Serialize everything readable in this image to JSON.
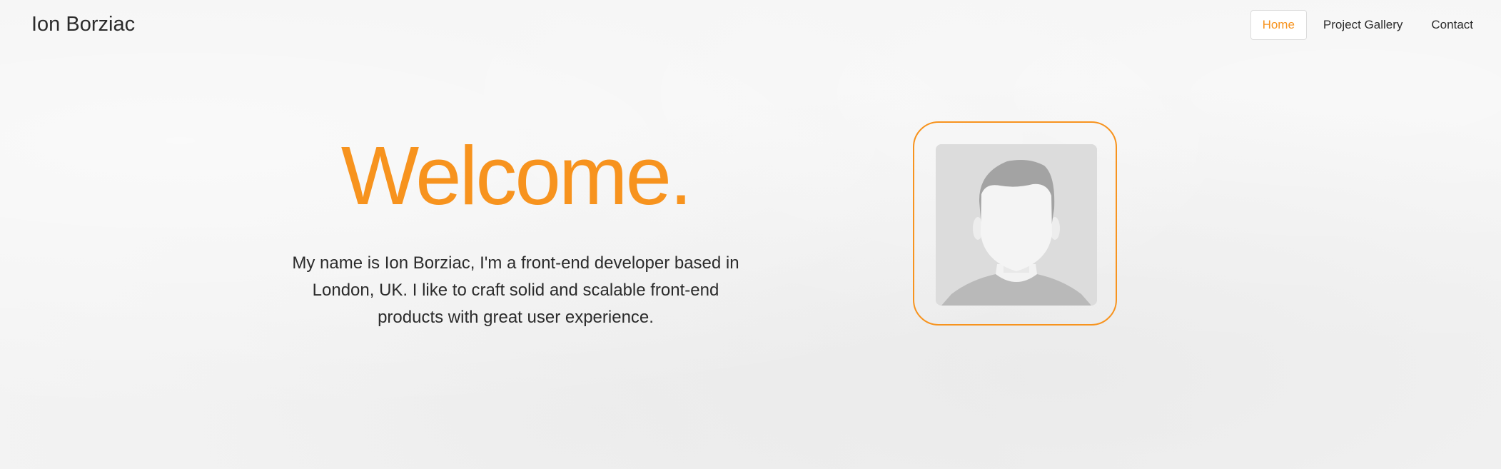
{
  "colors": {
    "accent": "#f7931e",
    "text": "#2b2b2b",
    "background": "#f3f3f3"
  },
  "header": {
    "brand": "Ion Borziac",
    "nav": [
      {
        "label": "Home",
        "active": true
      },
      {
        "label": "Project Gallery",
        "active": false
      },
      {
        "label": "Contact",
        "active": false
      }
    ]
  },
  "hero": {
    "title": "Welcome.",
    "intro": "My name is Ion Borziac, I'm a front-end developer based in London, UK. I like to craft solid and scalable front-end products with great user experience."
  },
  "profile": {
    "image_icon": "avatar-placeholder-icon"
  }
}
